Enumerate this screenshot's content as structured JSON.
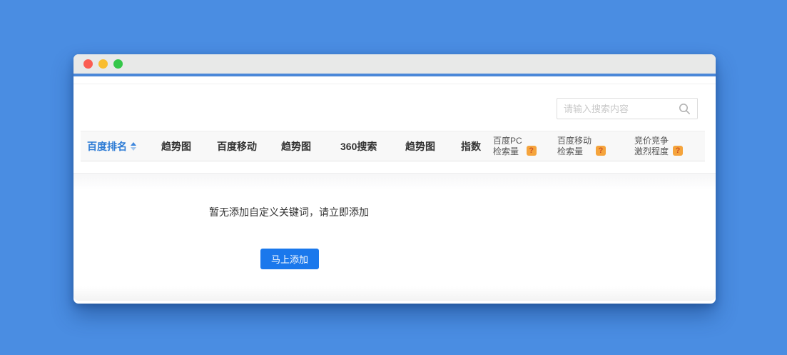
{
  "window": {
    "controls": [
      {
        "name": "close",
        "color": "#fb5c51"
      },
      {
        "name": "minimize",
        "color": "#f9bd2e"
      },
      {
        "name": "maximize",
        "color": "#34c749"
      }
    ]
  },
  "search": {
    "placeholder": "请输入搜索内容"
  },
  "table": {
    "help_badge": "?",
    "columns": [
      {
        "label": "百度排名",
        "sortable": true
      },
      {
        "label": "趋势图"
      },
      {
        "label": "百度移动"
      },
      {
        "label": "趋势图"
      },
      {
        "label": "360搜索"
      },
      {
        "label": "趋势图"
      },
      {
        "label": "指数"
      },
      {
        "line1": "百度PC",
        "line2": "检索量",
        "help": true
      },
      {
        "line1": "百度移动",
        "line2": "检索量",
        "help": true
      },
      {
        "line1": "竞价竞争",
        "line2": "激烈程度",
        "help": true
      }
    ]
  },
  "empty_state": {
    "message": "暂无添加自定义关键词，请立即添加",
    "button_label": "马上添加"
  },
  "colors": {
    "page_background": "#4a8de2",
    "accent_blue": "#2e7cd5",
    "button_blue": "#1a78ec",
    "help_badge_orange": "#f5a43c",
    "titlebar_border": "#4a87d8"
  }
}
